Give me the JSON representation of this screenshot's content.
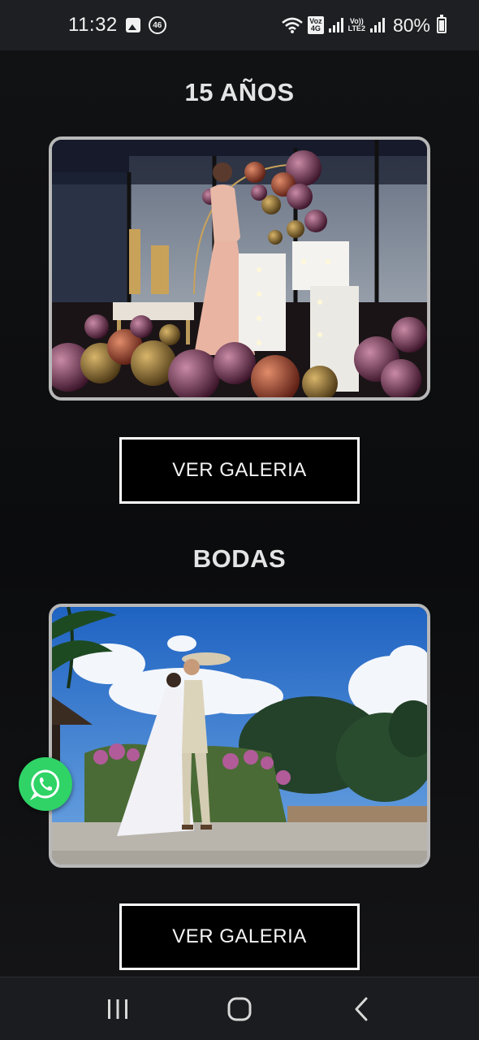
{
  "status_bar": {
    "time": "11:32",
    "badge": "46",
    "volte_top": "Voz",
    "volte_bottom": "4G",
    "lte_top": "Vo))",
    "lte_bottom": "LTE2",
    "battery": "80%"
  },
  "sections": [
    {
      "title": "15 AÑOS",
      "button_label": "VER GALERIA",
      "photo_icon": "quinceanera-photo"
    },
    {
      "title": "BODAS",
      "button_label": "VER GALERIA",
      "photo_icon": "wedding-photo"
    }
  ],
  "floating_button": {
    "icon": "whatsapp-icon",
    "color": "#2fd366"
  },
  "nav_bar": {
    "icons": [
      "recent-apps-icon",
      "home-icon",
      "back-icon"
    ]
  }
}
